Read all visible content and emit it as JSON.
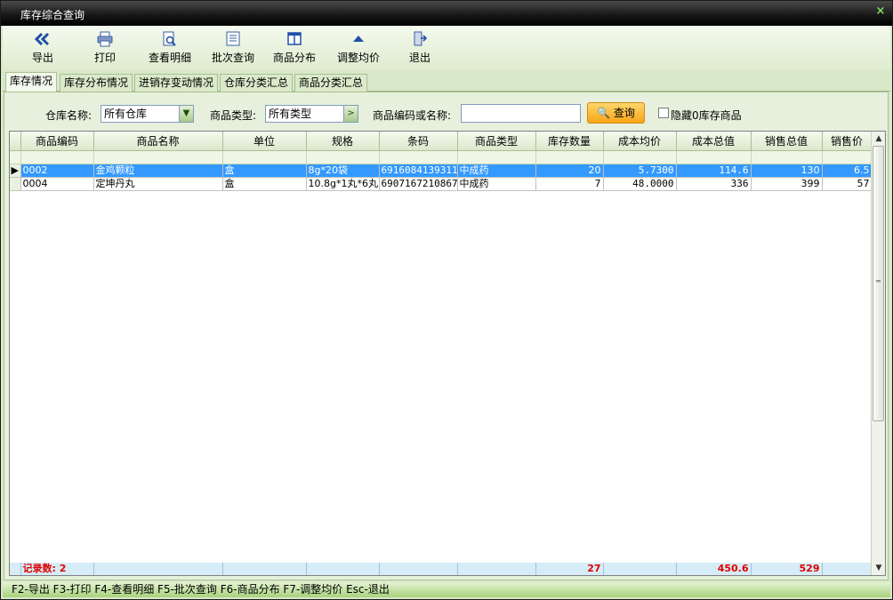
{
  "window": {
    "title": "库存综合查询",
    "close_glyph": "×"
  },
  "toolbar": {
    "buttons": [
      {
        "label": "导出",
        "icon": "double-left-arrow-icon"
      },
      {
        "label": "打印",
        "icon": "printer-icon"
      },
      {
        "label": "查看明细",
        "icon": "magnifier-document-icon"
      },
      {
        "label": "批次查询",
        "icon": "list-document-icon"
      },
      {
        "label": "商品分布",
        "icon": "columns-icon"
      },
      {
        "label": "调整均价",
        "icon": "up-triangle-icon"
      },
      {
        "label": "退出",
        "icon": "exit-door-icon"
      }
    ]
  },
  "tabs": [
    {
      "label": "库存情况",
      "active": true
    },
    {
      "label": "库存分布情况",
      "active": false
    },
    {
      "label": "进销存变动情况",
      "active": false
    },
    {
      "label": "仓库分类汇总",
      "active": false
    },
    {
      "label": "商品分类汇总",
      "active": false
    }
  ],
  "filters": {
    "warehouse_label": "仓库名称:",
    "warehouse_value": "所有仓库",
    "category_label": "商品类型:",
    "category_value": "所有类型",
    "code_label": "商品编码或名称:",
    "code_value": "",
    "search_label": "查询",
    "hide_zero_label": "隐藏0库存商品",
    "hide_zero_checked": false
  },
  "grid": {
    "columns": [
      "商品编码",
      "商品名称",
      "单位",
      "规格",
      "条码",
      "商品类型",
      "库存数量",
      "成本均价",
      "成本总值",
      "销售总值",
      "销售价"
    ],
    "rows": [
      [
        "0002",
        "金鸡颗粒",
        "盒",
        "8g*20袋",
        "6916084139311",
        "中成药",
        "20",
        "5.7300",
        "114.6",
        "130",
        "6.5"
      ],
      [
        "0004",
        "定坤丹丸",
        "盒",
        "10.8g*1丸*6丸",
        "6907167210867",
        "中成药",
        "7",
        "48.0000",
        "336",
        "399",
        "57"
      ]
    ],
    "selected_row": 0,
    "footer": {
      "record_count": "记录数: 2",
      "stock_qty_total": "27",
      "cost_total": "450.6",
      "sales_total": "529"
    }
  },
  "statusbar": {
    "text": "F2-导出 F3-打印 F4-查看明细 F5-批次查询 F6-商品分布 F7-调整均价 Esc-退出"
  },
  "colors": {
    "selection": "#3399ff",
    "footer_text": "#e00000",
    "search_button": "#f6a517",
    "panel_bg": "#e7f0dc"
  }
}
